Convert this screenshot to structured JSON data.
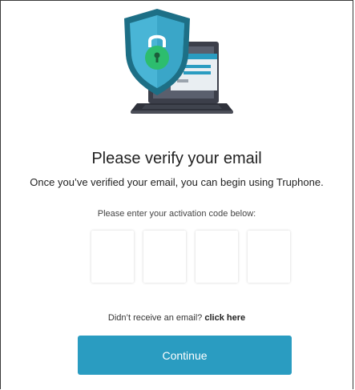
{
  "verify": {
    "title": "Please verify your email",
    "subtitle": "Once you’ve verified your email, you can begin using Truphone.",
    "code_prompt": "Please enter your activation code below:",
    "code_digits": [
      "",
      "",
      "",
      ""
    ],
    "resend_text": "Didn’t receive an email?",
    "resend_link": "click here",
    "continue_label": "Continue"
  },
  "colors": {
    "accent": "#2a9cc1",
    "shield_dark": "#1d6f86",
    "shield_light": "#49b5d6",
    "lock_green": "#2dbd6e",
    "laptop": "#3c3f4a"
  },
  "icons": {
    "illustration": "shield-laptop-security-icon"
  }
}
